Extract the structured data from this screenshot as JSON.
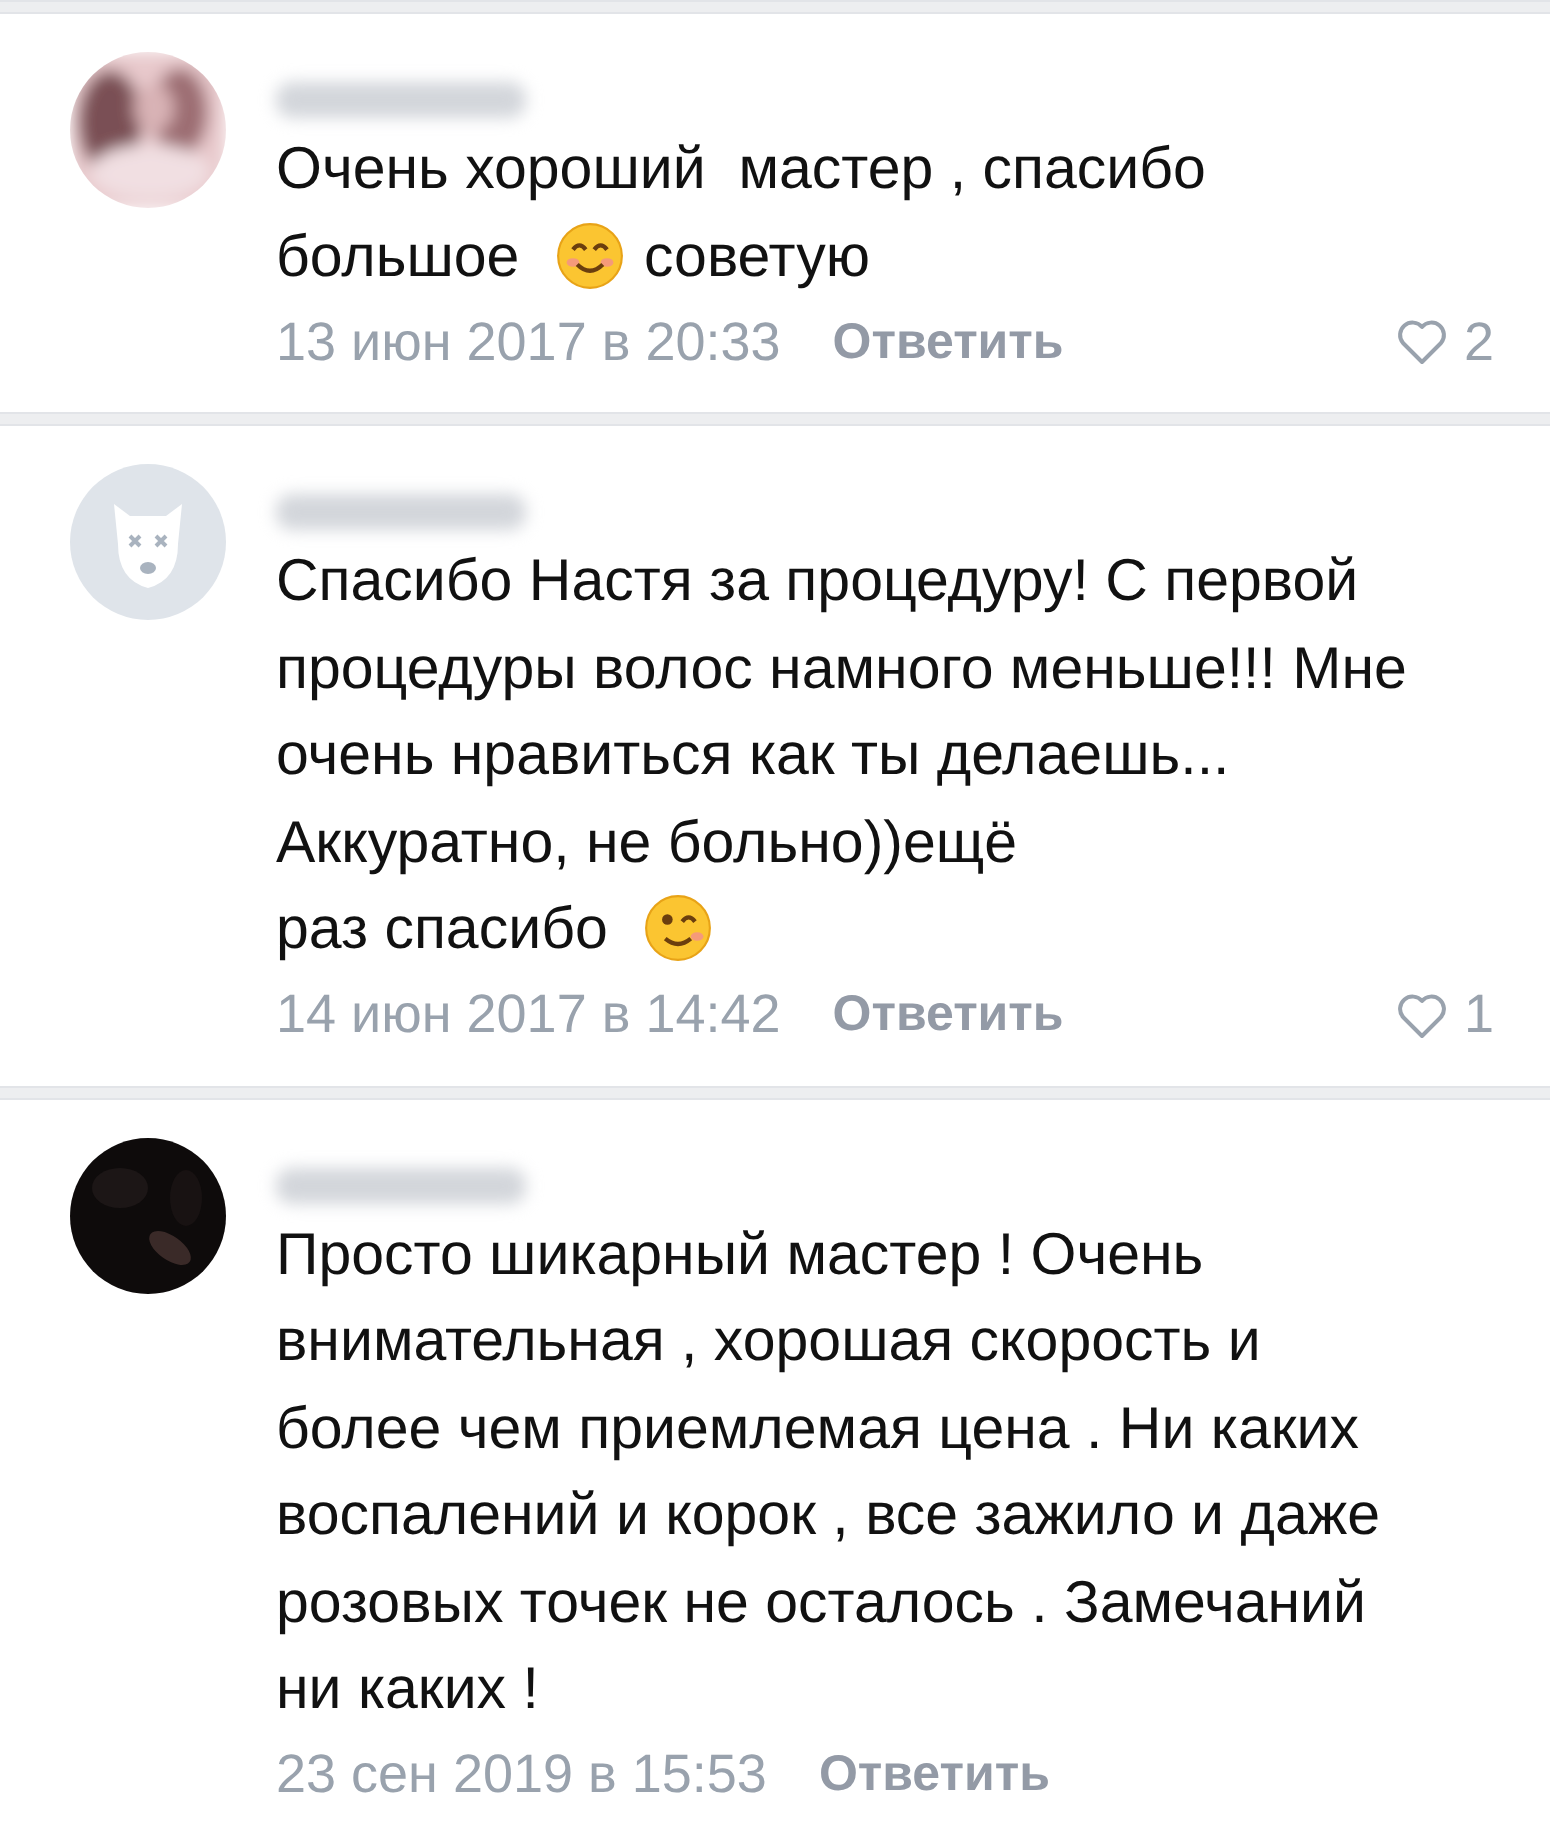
{
  "comments": [
    {
      "body": [
        {
          "kind": "text",
          "text": "Очень хороший  мастер , спасибо"
        },
        {
          "kind": "text",
          "text": "большое"
        },
        {
          "kind": "smile"
        },
        {
          "kind": "text",
          "text": "советую"
        }
      ],
      "date": "13 июн 2017 в 20:33",
      "reply": "Ответить",
      "likes": "2"
    },
    {
      "avatar": {
        "kind": "default"
      },
      "body": [
        {
          "kind": "text",
          "text": "Спасибо Настя за процедуру! С первой процедуры волос намного меньше!!! Мне очень нравиться как ты делаешь... Аккуратно, не больно))ещё"
        },
        {
          "kind": "text",
          "text": "раз спасибо"
        },
        {
          "kind": "wink"
        }
      ],
      "date": "14 июн 2017 в 14:42",
      "reply": "Ответить",
      "likes": "1"
    },
    {
      "avatar": {
        "kind": "dark-picture"
      },
      "body": [
        {
          "kind": "text",
          "text": "Просто шикарный мастер ! Очень внимательная , хорошая скорость и более чем приемлемая цена . Ни каких воспалений и корок , все зажило и даже розовых точек не осталось . Замечаний ни каких !"
        }
      ],
      "date": "23 сен 2019 в 15:53",
      "reply": "Ответить"
    }
  ]
}
